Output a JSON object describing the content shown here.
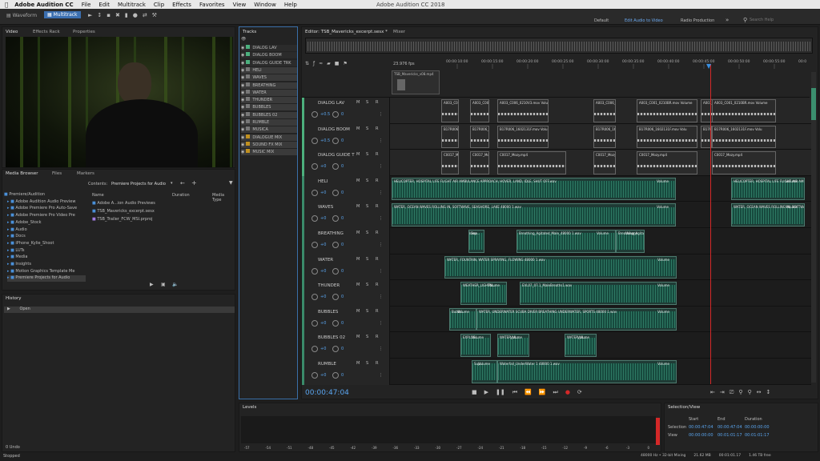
{
  "app": {
    "name": "Adobe Audition CC",
    "title": "Adobe Audition CC 2018"
  },
  "menu": [
    "File",
    "Edit",
    "Multitrack",
    "Clip",
    "Effects",
    "Favorites",
    "View",
    "Window",
    "Help"
  ],
  "toolbar": {
    "waveform": "Waveform",
    "multitrack": "Multitrack",
    "workspaces": [
      "Default",
      "Edit Audio to Video",
      "Radio Production"
    ],
    "search_placeholder": "Search Help"
  },
  "video_panel": {
    "tabs": [
      "Video",
      "Effects Rack",
      "Properties"
    ]
  },
  "tracks_panel": {
    "title": "Tracks",
    "items": [
      "DIALOG LAV",
      "DIALOG BOOM",
      "DIALOG GUIDE TRK",
      "HELI",
      "WAVES",
      "BREATHING",
      "WATER",
      "THUNDER",
      "BUBBLES",
      "BUBBLES 02",
      "RUMBLE",
      "MUSICA",
      "DIALOGUE MIX",
      "SOUND FX MIX",
      "MUSIC MIX"
    ]
  },
  "media_browser": {
    "tabs": [
      "Media Browser",
      "Files",
      "Markers"
    ],
    "contents_label": "Contents:",
    "contents_value": "Premiere Projects for Audio",
    "tree": [
      "Premiere/Audition",
      "Adobe Audition Audio Preview",
      "Adobe Premiere Pro Auto-Save",
      "Adobe Premiere Pro Video Pre",
      "Adobe_Stock",
      "Audio",
      "Docs",
      "iPhone_Kylie_Shoot",
      "LUTs",
      "Media",
      "Insights",
      "Motion Graphics Template Me",
      "Premiere Projects for Audio"
    ],
    "columns": [
      "Name",
      "Duration",
      "Media Type"
    ],
    "files": [
      "Adobe A...ion Audio Previews",
      "TSB_Mavericks_excerpt.sesx",
      "TSB_Trailer_FCW_MSI.prproj"
    ]
  },
  "history": {
    "title": "History",
    "items": [
      "Open"
    ],
    "undo": "0 Undo"
  },
  "status": {
    "left": "Stopped",
    "right": [
      "48000 Hz • 32-bit Mixing",
      "21.62 MB",
      "00:01:01.17",
      "1.46 TB free"
    ]
  },
  "editor": {
    "tab": "Editor: TSB_Mavericks_excerpt.sesx *",
    "mixer": "Mixer",
    "fps": "23.976 fps",
    "video_clip": "TSB_Mavericks_v08.mp4",
    "ruler": [
      "00:00:10:00",
      "00:00:15:00",
      "00:00:20:00",
      "00:00:25:00",
      "00:00:30:00",
      "00:00:35:00",
      "00:00:40:00",
      "00:00:45:00",
      "00:00:50:00",
      "00:00:55:00",
      "00:01:00:00"
    ],
    "timecode": "00:00:47:04"
  },
  "lanes": [
    {
      "name": "DIALOG LAV",
      "vol": "+0.5",
      "pan": "0",
      "kind": "dialog"
    },
    {
      "name": "DIALOG BOOM",
      "vol": "+0.5",
      "pan": "0",
      "kind": "dialog"
    },
    {
      "name": "DIALOG GUIDE T",
      "vol": "+0",
      "pan": "0",
      "kind": "dialog"
    },
    {
      "name": "HELI",
      "vol": "+0",
      "pan": "0",
      "kind": "fx"
    },
    {
      "name": "WAVES",
      "vol": "+0",
      "pan": "0",
      "kind": "fx"
    },
    {
      "name": "BREATHING",
      "vol": "+0",
      "pan": "0",
      "kind": "fx"
    },
    {
      "name": "WATER",
      "vol": "+0",
      "pan": "0",
      "kind": "fx"
    },
    {
      "name": "THUNDER",
      "vol": "+0",
      "pan": "0",
      "kind": "fx"
    },
    {
      "name": "BUBBLES",
      "vol": "+0",
      "pan": "0",
      "kind": "fx"
    },
    {
      "name": "BUBBLES 02",
      "vol": "+0",
      "pan": "0",
      "kind": "fx"
    },
    {
      "name": "RUMBLE",
      "vol": "+0",
      "pan": "0",
      "kind": "fx"
    }
  ],
  "clip_labels": [
    "A003_C006_0210V3.mov Volu",
    "A003_C001_0210BR.mov Volume",
    "B17R006_1602131F.mov Volu",
    "C0017_Mozy.mp4",
    "Volume",
    "HELICOPTER, HOSPITAL LIFE FLIGHT AIR AMBULANCE APPROACH, HOVER, LAND, IDLE, SHUT OFF.wav",
    "WATER, OCEAN WAVES ROLLING IN, SOFTWAVE, SEASHORE, LAKE 48000 1.wav",
    "Breathing_Agitated_Male_48000 1.wav",
    "WATER, FOUNTAIN, WATER SPRAYING, FLOWING 48000 1.wav",
    "WEATHER_LIGHTN...",
    "EVL07_07.1_MaleBreaths1.wav",
    "WATER, UNDERWATER SCUBA DIVER BREATHING UNDERWATER, SPORTS 48000 1.wav",
    "WATER_UL...",
    "Waterfall_UnderWater 1 48000 1.wav",
    "Bubbl...",
    "EXPLOS...",
    "Sup..."
  ],
  "transport": [
    "stop",
    "play",
    "pause",
    "to-start",
    "rewind",
    "fast-forward",
    "to-end",
    "record",
    "loop"
  ],
  "levels": {
    "title": "Levels",
    "scale": [
      "-57",
      "-54",
      "-51",
      "-48",
      "-45",
      "-42",
      "-39",
      "-36",
      "-33",
      "-30",
      "-27",
      "-24",
      "-21",
      "-18",
      "-15",
      "-12",
      "-9",
      "-6",
      "-3",
      "0"
    ]
  },
  "selection": {
    "title": "Selection/View",
    "headers": [
      "Start",
      "End",
      "Duration"
    ],
    "rows": [
      {
        "label": "Selection",
        "start": "00:00:47:04",
        "end": "00:00:47:04",
        "dur": "00:00:00:00"
      },
      {
        "label": "View",
        "start": "00:00:00:00",
        "end": "00:01:01:17",
        "dur": "00:01:01:17"
      }
    ]
  },
  "colors": {
    "accent": "#3b8fe0",
    "playhead": "#d42828",
    "clip": "#1f3b35",
    "wave": "#2e7a64"
  }
}
